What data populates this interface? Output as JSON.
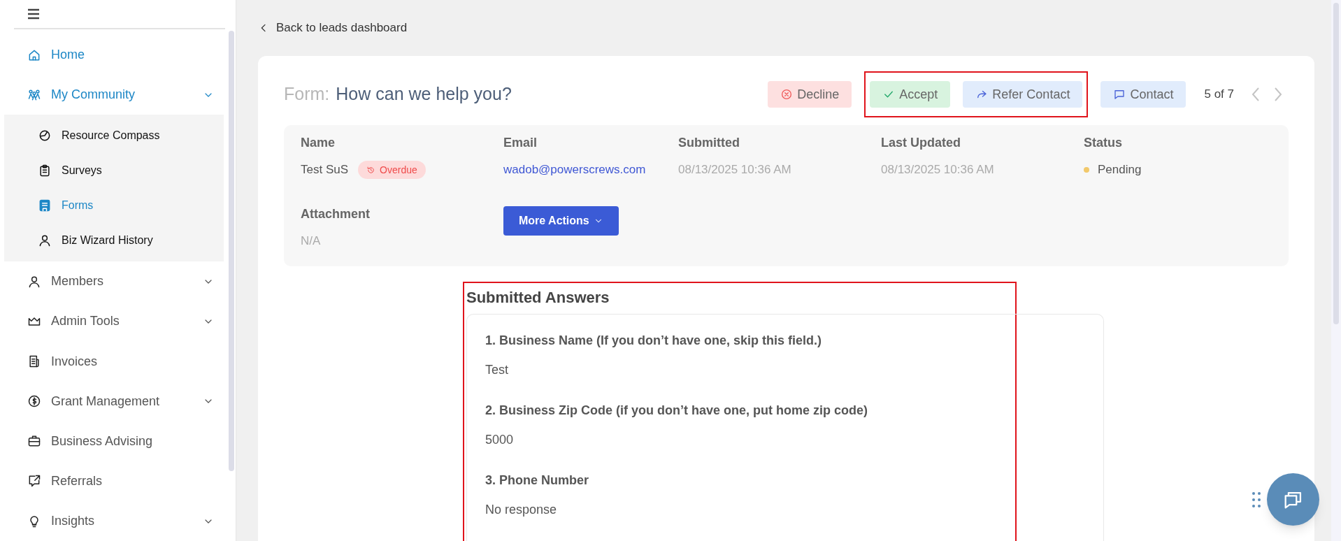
{
  "sidebar": {
    "items": [
      {
        "label": "Home",
        "selected": true,
        "expandable": false
      },
      {
        "label": "My Community",
        "selected": true,
        "expandable": true,
        "expanded": true,
        "children": [
          {
            "label": "Resource Compass",
            "selected": false
          },
          {
            "label": "Surveys",
            "selected": false
          },
          {
            "label": "Forms",
            "selected": true
          },
          {
            "label": "Biz Wizard History",
            "selected": false
          }
        ]
      },
      {
        "label": "Members",
        "selected": false,
        "expandable": true,
        "expanded": false
      },
      {
        "label": "Admin Tools",
        "selected": false,
        "expandable": true,
        "expanded": false
      },
      {
        "label": "Invoices",
        "selected": false,
        "expandable": false
      },
      {
        "label": "Grant Management",
        "selected": false,
        "expandable": true,
        "expanded": false
      },
      {
        "label": "Business Advising",
        "selected": false,
        "expandable": false
      },
      {
        "label": "Referrals",
        "selected": false,
        "expandable": false
      },
      {
        "label": "Insights",
        "selected": false,
        "expandable": true,
        "expanded": false
      }
    ]
  },
  "back_link": "Back to leads dashboard",
  "form": {
    "prefix": "Form:",
    "title": "How can we help you?"
  },
  "actions": [
    {
      "kind": "decline",
      "label": "Decline",
      "highlighted": false
    },
    {
      "kind": "accept",
      "label": "Accept",
      "highlighted": true
    },
    {
      "kind": "refer",
      "label": "Refer Contact",
      "highlighted": true
    },
    {
      "kind": "contact",
      "label": "Contact",
      "highlighted": false
    }
  ],
  "pager": {
    "text": "5 of 7"
  },
  "details": [
    {
      "kind": "name",
      "label": "Name",
      "value": "Test SuS",
      "badge": "Overdue"
    },
    {
      "kind": "link",
      "label": "Email",
      "value": "wadob@powerscrews.com"
    },
    {
      "kind": "muted",
      "label": "Submitted",
      "value": "08/13/2025 10:36 AM"
    },
    {
      "kind": "muted",
      "label": "Last Updated",
      "value": "08/13/2025 10:36 AM"
    },
    {
      "kind": "status",
      "label": "Status",
      "value": "Pending",
      "color": "#f2c96b"
    },
    {
      "kind": "muted",
      "label": "Attachment",
      "value": "N/A"
    },
    {
      "kind": "button",
      "label": "More Actions"
    }
  ],
  "answers": {
    "title": "Submitted Answers",
    "highlighted": true,
    "items": [
      {
        "question": "1. Business Name (If you don’t have one, skip this field.)",
        "answer": "Test"
      },
      {
        "question": "2. Business Zip Code (if you don’t have one, put home zip code)",
        "answer": "5000"
      },
      {
        "question": "3. Phone Number",
        "answer": "No response"
      }
    ]
  }
}
